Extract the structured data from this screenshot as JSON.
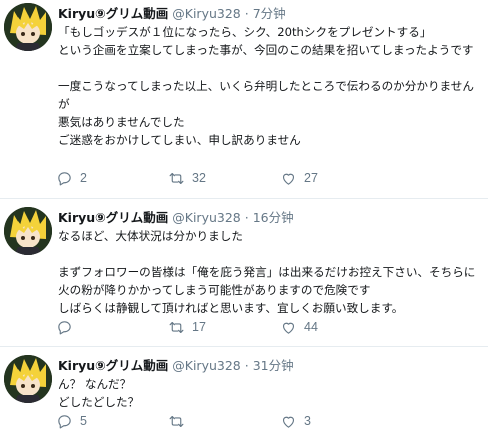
{
  "tweets": [
    {
      "name": "Kiryu⑨グリム動画",
      "handle": "@Kiryu328",
      "separator": "·",
      "time": "7分钟",
      "text": "「もしゴッデスが１位になったら、シク、20thシクをプレゼントする」\nという企画を立案してしまった事が、今回のこの結果を招いてしまったようです\n\n一度こうなってしまった以上、いくら弁明したところで伝わるのか分かりませんが\n悪気はありませんでした\nご迷惑をおかけしてしまい、申し訳ありません",
      "replies": "2",
      "retweets": "32",
      "likes": "27"
    },
    {
      "name": "Kiryu⑨グリム動画",
      "handle": "@Kiryu328",
      "separator": "·",
      "time": "16分钟",
      "text": "なるほど、大体状況は分かりました\n\nまずフォロワーの皆様は「俺を庇う発言」は出来るだけお控え下さい、そちらに火の粉が降りかかってしまう可能性がありますので危険です\nしばらくは静観して頂ければと思います、宜しくお願い致します。",
      "replies": "",
      "retweets": "17",
      "likes": "44"
    },
    {
      "name": "Kiryu⑨グリム動画",
      "handle": "@Kiryu328",
      "separator": "·",
      "time": "31分钟",
      "text": "ん？ なんだ？\nどしたどした？",
      "replies": "5",
      "retweets": "",
      "likes": "3"
    }
  ],
  "icons": {
    "reply": "reply-icon",
    "retweet": "retweet-icon",
    "like": "heart-icon",
    "avatar": "avatar"
  },
  "colors": {
    "text": "#14171a",
    "secondary": "#657786",
    "divider": "#e6ecf0"
  }
}
